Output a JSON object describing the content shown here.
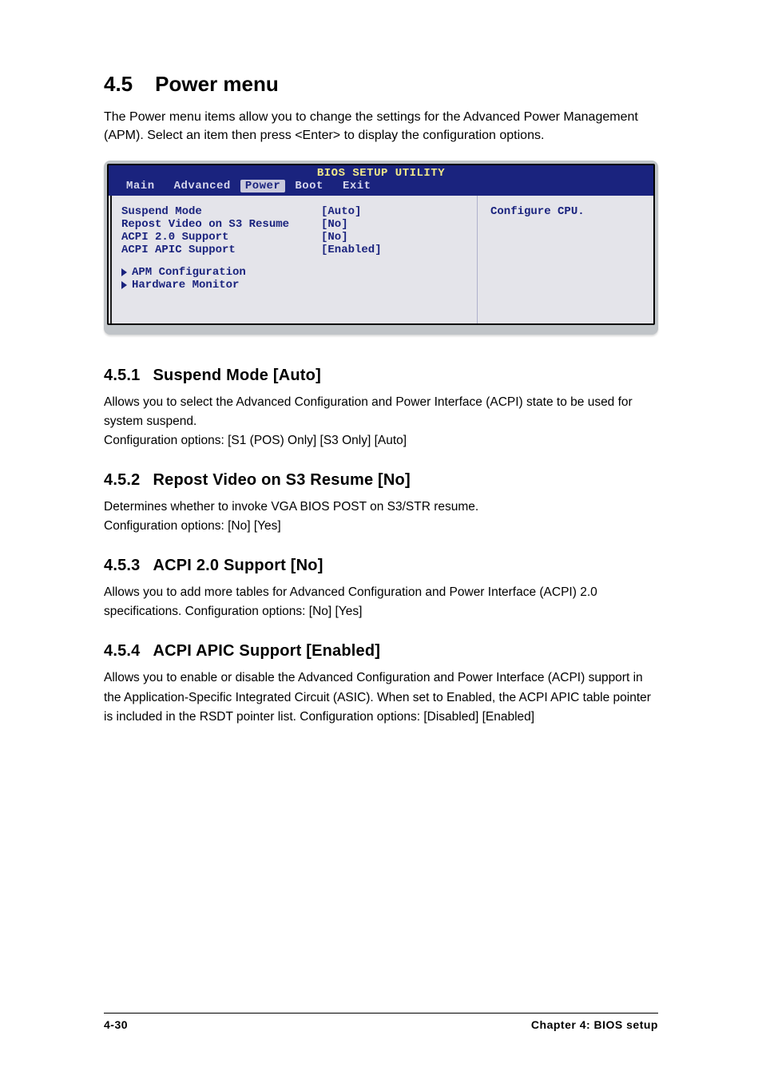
{
  "section": {
    "number": "4.5",
    "title": "Power menu",
    "intro": "The Power menu items allow you to change the settings for the Advanced Power Management (APM). Select an item then press <Enter> to display the configuration options."
  },
  "bios": {
    "title": "BIOS SETUP UTILITY",
    "tabs": [
      "Main",
      "Advanced",
      "Power",
      "Boot",
      "Exit"
    ],
    "activeTab": "Power",
    "rows": [
      {
        "label": "Suspend Mode",
        "value": "[Auto]"
      },
      {
        "label": "Repost Video on S3 Resume",
        "value": "[No]"
      },
      {
        "label": "ACPI 2.0 Support",
        "value": "[No]"
      },
      {
        "label": "ACPI APIC Support",
        "value": "[Enabled]"
      }
    ],
    "submenus": [
      "APM Configuration",
      "Hardware Monitor"
    ],
    "help": "Configure CPU."
  },
  "subsections": [
    {
      "number": "4.5.1",
      "title": "Suspend Mode [Auto]",
      "body": "Allows you to select the Advanced Configuration and Power Interface (ACPI) state to be used for system suspend.\nConfiguration options: [S1 (POS) Only] [S3 Only] [Auto]"
    },
    {
      "number": "4.5.2",
      "title": "Repost Video on S3 Resume [No]",
      "body": "Determines whether to invoke VGA BIOS POST on S3/STR resume.\nConfiguration options: [No] [Yes]"
    },
    {
      "number": "4.5.3",
      "title": "ACPI 2.0 Support [No]",
      "body": "Allows you to add more tables for Advanced Configuration and Power Interface (ACPI) 2.0 specifications. Configuration options: [No] [Yes]"
    },
    {
      "number": "4.5.4",
      "title": "ACPI APIC Support [Enabled]",
      "body": "Allows you to enable or disable the Advanced Configuration and Power Interface (ACPI) support in the Application-Specific Integrated Circuit (ASIC). When set to Enabled, the ACPI APIC table pointer is included in the RSDT pointer list. Configuration options: [Disabled] [Enabled]"
    }
  ],
  "footer": {
    "page": "4-30",
    "chapter": "Chapter 4: BIOS setup"
  }
}
